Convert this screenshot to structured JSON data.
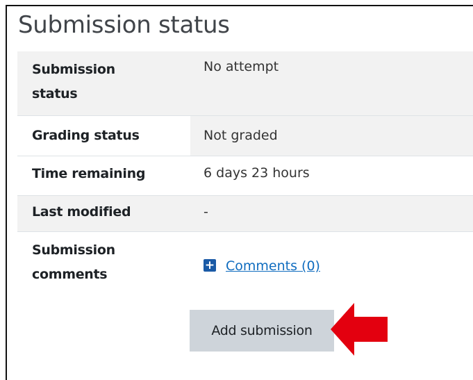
{
  "title": "Submission status",
  "rows": [
    {
      "label_line1": "Submission",
      "label_line2": "status",
      "value": "No attempt"
    },
    {
      "label": "Grading status",
      "value": "Not graded"
    },
    {
      "label": "Time remaining",
      "value": "6 days 23 hours"
    },
    {
      "label": "Last modified",
      "value": "-"
    },
    {
      "label_line1": "Submission",
      "label_line2": "comments",
      "link_text": "Comments (0)"
    }
  ],
  "add_button": "Add submission",
  "plus_icon": "+",
  "colors": {
    "shade": "#f2f2f2",
    "link": "#0f6cbf",
    "button": "#ced4da",
    "arrow": "#e3000f",
    "icon": "#1a5aa6"
  }
}
